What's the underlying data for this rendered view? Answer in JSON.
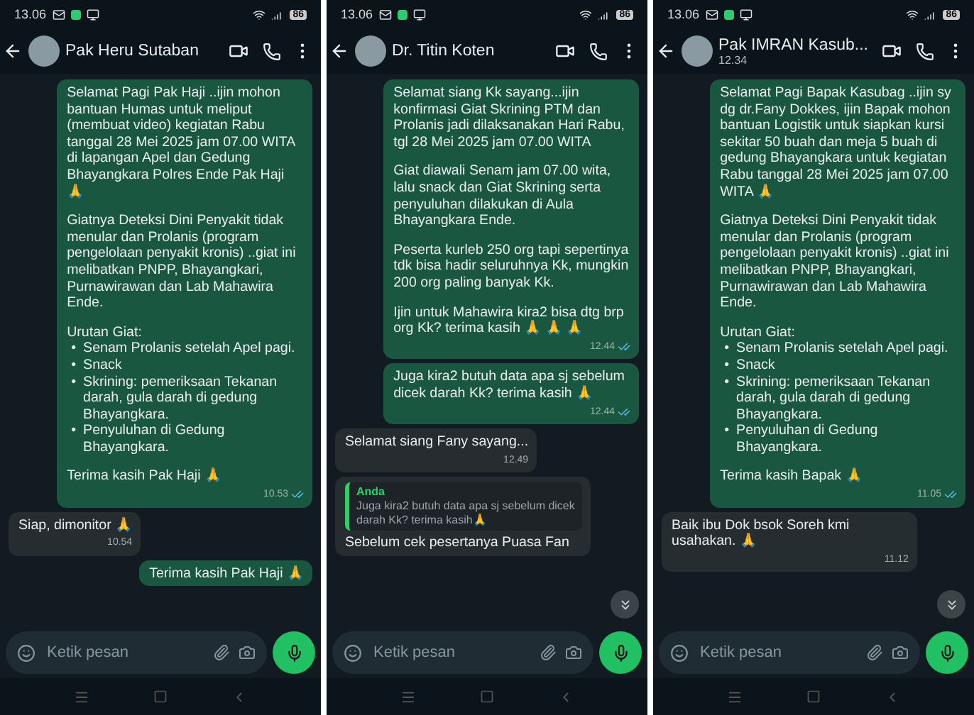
{
  "phones": [
    {
      "status": {
        "time": "13.06",
        "battery": "86"
      },
      "contact": {
        "name": "Pak Heru Sutaban"
      },
      "scroll_down_button": false,
      "input": {
        "placeholder": "Ketik pesan"
      },
      "messages": [
        {
          "kind": "out",
          "blocks": [
            {
              "kind": "text",
              "text": "Selamat Pagi Pak Haji ..ijin mohon bantuan Humas untuk meliput (membuat video) kegiatan Rabu tanggal 28 Mei 2025 jam 07.00 WITA di lapangan Apel dan Gedung Bhayangkara Polres Ende Pak Haji 🙏"
            },
            {
              "kind": "text",
              "text": "Giatnya Deteksi Dini Penyakit tidak menular dan Prolanis (program pengelolaan penyakit kronis) ..giat ini melibatkan PNPP, Bhayangkari, Purnawirawan dan Lab Mahawira Ende."
            },
            {
              "kind": "list",
              "title": "Urutan Giat:",
              "bullet": "•",
              "items": [
                "Senam Prolanis setelah Apel pagi.",
                "Snack",
                "Skrining: pemeriksaan Tekanan darah, gula darah di gedung Bhayangkara.",
                "Penyuluhan di Gedung Bhayangkara."
              ]
            },
            {
              "kind": "text",
              "text": "Terima kasih Pak Haji 🙏"
            }
          ],
          "time": "10.53",
          "read": true
        },
        {
          "kind": "in",
          "blocks": [
            {
              "kind": "text",
              "text": "Siap, dimonitor 🙏"
            }
          ],
          "time": "10.54"
        },
        {
          "kind": "out",
          "blocks": [
            {
              "kind": "text",
              "text": "Terima kasih Pak Haji 🙏"
            }
          ]
        }
      ]
    },
    {
      "status": {
        "time": "13.06",
        "battery": "86"
      },
      "contact": {
        "name": "Dr. Titin Koten"
      },
      "scroll_down_button": true,
      "input": {
        "placeholder": "Ketik pesan"
      },
      "messages": [
        {
          "kind": "out",
          "blocks": [
            {
              "kind": "text",
              "text": "Selamat siang Kk sayang...ijin konfirmasi Giat Skrining PTM dan Prolanis jadi dilaksanakan Hari Rabu, tgl 28 Mei 2025 jam 07.00 WITA"
            },
            {
              "kind": "text",
              "text": "Giat diawali Senam jam 07.00 wita, lalu snack dan Giat Skrining serta penyuluhan dilakukan di Aula Bhayangkara Ende."
            },
            {
              "kind": "text",
              "text": "Peserta kurleb 250 org tapi sepertinya tdk bisa hadir seluruhnya Kk, mungkin 200 org paling banyak Kk."
            },
            {
              "kind": "text",
              "text": "Ijin untuk Mahawira kira2 bisa dtg brp org Kk? terima kasih 🙏 🙏 🙏"
            }
          ],
          "time": "12.44",
          "read": true
        },
        {
          "kind": "out",
          "blocks": [
            {
              "kind": "text",
              "text": "Juga kira2 butuh data apa sj sebelum dicek darah Kk? terima kasih 🙏"
            }
          ],
          "time": "12.44",
          "read": true
        },
        {
          "kind": "in",
          "blocks": [
            {
              "kind": "text",
              "text": "Selamat siang Fany sayang..."
            }
          ],
          "time": "12.49"
        },
        {
          "kind": "in",
          "quote": {
            "author": "Anda",
            "text": "Juga kira2 butuh data apa sj sebelum dicek darah Kk? terima kasih🙏"
          },
          "blocks": [
            {
              "kind": "text",
              "text": "Sebelum cek pesertanya Puasa Fan"
            }
          ]
        }
      ]
    },
    {
      "status": {
        "time": "13.06",
        "battery": "86"
      },
      "contact": {
        "name": "Pak IMRAN Kasub...",
        "subtitle": "12.34"
      },
      "scroll_down_button": true,
      "input": {
        "placeholder": "Ketik pesan"
      },
      "messages": [
        {
          "kind": "out",
          "blocks": [
            {
              "kind": "text",
              "text": "Selamat Pagi Bapak Kasubag ..ijin sy dg dr.Fany Dokkes, ijin Bapak mohon bantuan Logistik untuk siapkan kursi sekitar 50 buah dan meja 5 buah di gedung Bhayangkara untuk kegiatan Rabu tanggal 28 Mei 2025 jam 07.00 WITA 🙏"
            },
            {
              "kind": "text",
              "text": "Giatnya Deteksi Dini Penyakit tidak menular dan Prolanis (program pengelolaan penyakit kronis) ..giat ini melibatkan PNPP, Bhayangkari, Purnawirawan dan Lab Mahawira Ende."
            },
            {
              "kind": "list",
              "title": "Urutan Giat:",
              "bullet": "•",
              "items": [
                "Senam Prolanis setelah Apel pagi.",
                "Snack",
                "Skrining: pemeriksaan Tekanan darah, gula darah di gedung Bhayangkara.",
                "Penyuluhan di Gedung Bhayangkara."
              ]
            },
            {
              "kind": "text",
              "text": "Terima kasih Bapak 🙏"
            }
          ],
          "time": "11.05",
          "read": true
        },
        {
          "kind": "in",
          "blocks": [
            {
              "kind": "text",
              "text": "Baik ibu Dok bsok Soreh kmi usahakan. 🙏"
            }
          ],
          "time": "11.12"
        }
      ]
    }
  ]
}
